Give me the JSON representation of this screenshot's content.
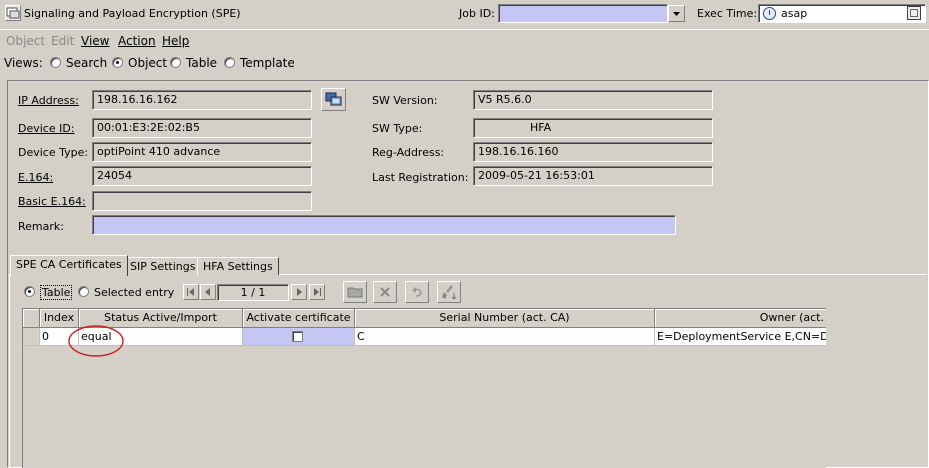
{
  "window": {
    "title": "Signaling and Payload Encryption (SPE)"
  },
  "header": {
    "job_id_label": "Job ID:",
    "job_id_value": "",
    "exec_time_label": "Exec Time:",
    "exec_time_value": "asap"
  },
  "menu": {
    "items": [
      {
        "label": "Object",
        "enabled": false
      },
      {
        "label": "Edit",
        "enabled": false
      },
      {
        "label": "View",
        "enabled": true
      },
      {
        "label": "Action",
        "enabled": true
      },
      {
        "label": "Help",
        "enabled": true
      }
    ]
  },
  "views": {
    "label": "Views:",
    "options": [
      "Search",
      "Object",
      "Table",
      "Template"
    ],
    "selected": "Object"
  },
  "device": {
    "ip_label": "IP Address:",
    "ip_value": "198.16.16.162",
    "device_id_label": "Device ID:",
    "device_id_value": "00:01:E3:2E:02:B5",
    "device_type_label": "Device Type:",
    "device_type_value": "optiPoint 410 advance",
    "e164_label": "E.164:",
    "e164_value": "24054",
    "basic_e164_label": "Basic E.164:",
    "basic_e164_value": "",
    "remark_label": "Remark:",
    "remark_value": "",
    "sw_version_label": "SW Version:",
    "sw_version_value": "V5 R5.6.0",
    "sw_type_label": "SW Type:",
    "sw_type_value": "HFA",
    "reg_address_label": "Reg-Address:",
    "reg_address_value": "198.16.16.160",
    "last_registration_label": "Last Registration:",
    "last_registration_value": "2009-05-21 16:53:01"
  },
  "tabs": [
    "SPE CA Certificates",
    "SIP Settings",
    "HFA Settings"
  ],
  "table_mode": {
    "table_label": "Table",
    "selected_entry_label": "Selected entry",
    "page_indicator": "1 / 1"
  },
  "table": {
    "columns": [
      "Index",
      "Status Active/Import",
      "Activate certificate",
      "Serial Number (act. CA)",
      "Owner (act."
    ],
    "rows": [
      {
        "index": "0",
        "status": "equal",
        "activate": false,
        "serial": "C",
        "owner": "E=DeploymentService E,CN=Dep"
      }
    ]
  },
  "colors": {
    "background": "#d4d0c8",
    "highlight_field": "#c6c6f5",
    "annotation_circle": "#cc2020"
  }
}
